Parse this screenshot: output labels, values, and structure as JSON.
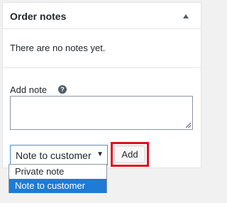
{
  "panel": {
    "title": "Order notes",
    "empty_message": "There are no notes yet."
  },
  "add_note": {
    "label": "Add note",
    "help_icon": "?",
    "textarea_value": "",
    "note_type_selected": "Note to customer",
    "select_arrow": "▼",
    "add_button_label": "Add",
    "options": [
      {
        "label": "Private note",
        "selected": false
      },
      {
        "label": "Note to customer",
        "selected": true
      }
    ]
  },
  "colors": {
    "highlight": "#e0101e",
    "selected_option": "#1e7bd6"
  },
  "icons": {
    "collapse": "triangle-up-icon",
    "help": "help-circle-icon",
    "resize": "resize-grip-icon"
  }
}
